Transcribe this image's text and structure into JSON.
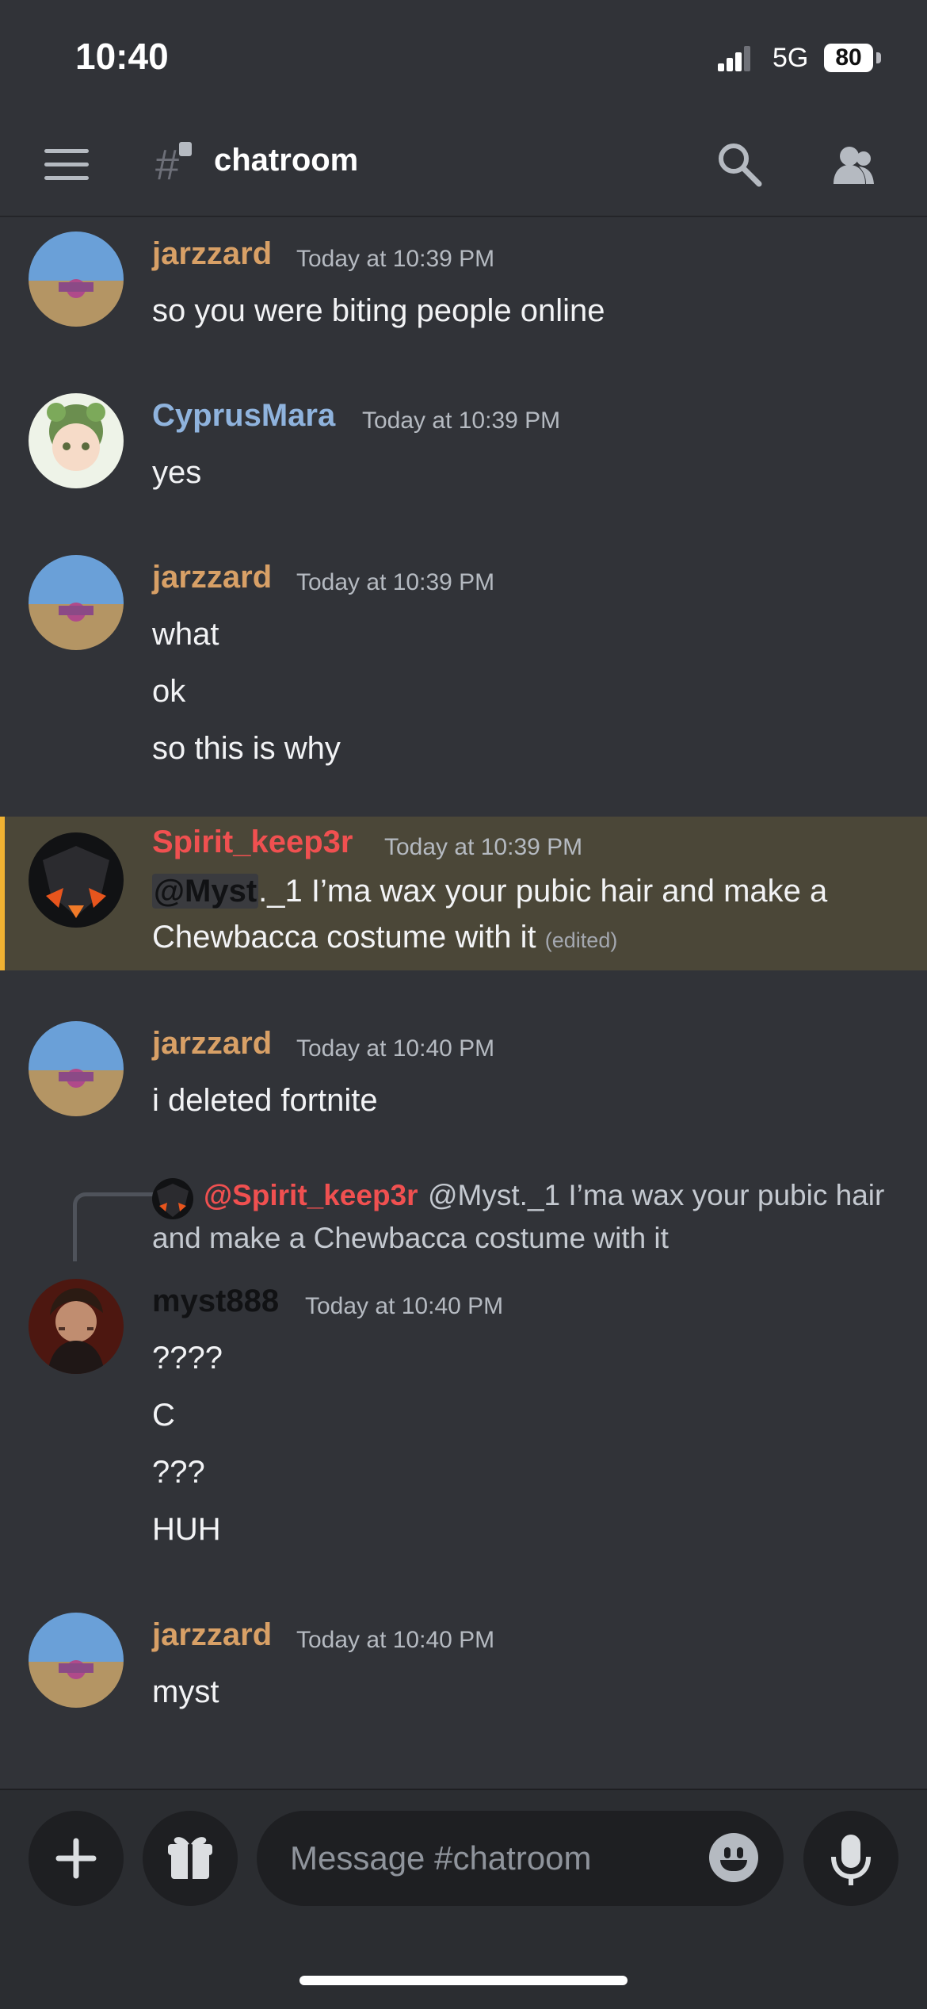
{
  "status": {
    "time": "10:40",
    "network": "5G",
    "battery": "80"
  },
  "header": {
    "channel_name": "chatroom",
    "icons": {
      "menu": "hamburger-menu-icon",
      "channel": "private-channel-hash-icon",
      "search": "search-icon",
      "members": "members-icon"
    }
  },
  "messages": [
    {
      "author": "jarzzard",
      "author_color": "#d8a066",
      "timestamp": "Today at 10:39 PM",
      "lines": [
        "so you were biting people online"
      ]
    },
    {
      "author": "CyprusMara",
      "author_color": "#8fb3dd",
      "timestamp": "Today at 10:39 PM",
      "lines": [
        "yes"
      ]
    },
    {
      "author": "jarzzard",
      "author_color": "#d8a066",
      "timestamp": "Today at 10:39 PM",
      "lines": [
        "what",
        "ok",
        "so this is why"
      ]
    },
    {
      "author": "Spirit_keep3r",
      "author_color": "#f05050",
      "timestamp": "Today at 10:39 PM",
      "mention": "@Myst",
      "line_1_after_mention": "._1 I’ma wax your pubic hair and make a",
      "line_2": "Chewbacca costume with it",
      "edited": "(edited)"
    },
    {
      "author": "jarzzard",
      "author_color": "#d8a066",
      "timestamp": "Today at 10:40 PM",
      "lines": [
        "i deleted fortnite"
      ]
    },
    {
      "reply": {
        "author": "@Spirit_keep3r",
        "author_color": "#f05050",
        "text_line_1": "@Myst._1 I’ma wax your pubic hair",
        "text_line_2": "and make a Chewbacca costume with it"
      },
      "author": "myst888",
      "author_color": "#111214",
      "timestamp": "Today at 10:40 PM",
      "lines": [
        "????",
        "C",
        "???",
        "HUH"
      ]
    },
    {
      "author": "jarzzard",
      "author_color": "#d8a066",
      "timestamp": "Today at 10:40 PM",
      "lines": [
        "myst"
      ]
    }
  ],
  "composer": {
    "placeholder": "Message #chatroom",
    "icons": {
      "add": "plus-icon",
      "gift": "gift-icon",
      "emoji": "emoji-icon",
      "microphone": "microphone-icon"
    }
  },
  "colors": {
    "background": "#313338",
    "highlight": "#4b4738",
    "highlight_bar": "#f0b232"
  }
}
